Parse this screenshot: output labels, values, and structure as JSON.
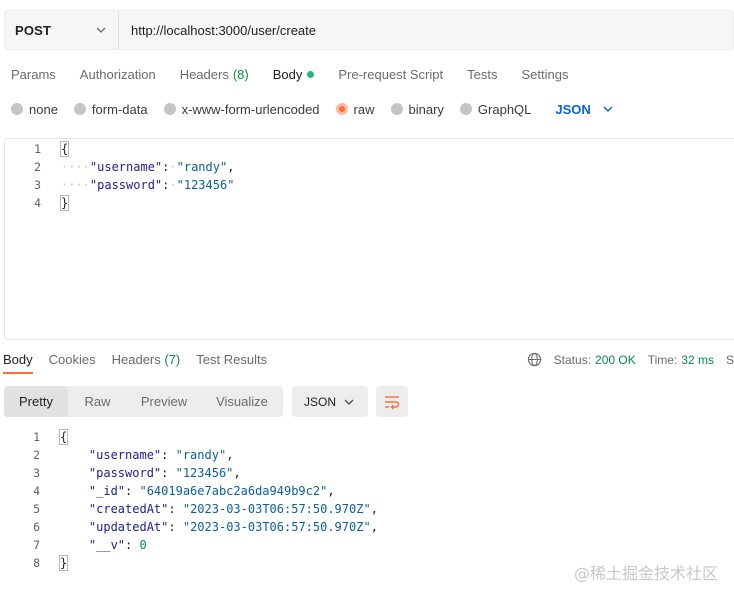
{
  "request": {
    "method": "POST",
    "url": "http://localhost:3000/user/create"
  },
  "request_tabs": [
    {
      "label": "Params"
    },
    {
      "label": "Authorization"
    },
    {
      "label": "Headers",
      "count": "(8)"
    },
    {
      "label": "Body"
    },
    {
      "label": "Pre-request Script"
    },
    {
      "label": "Tests"
    },
    {
      "label": "Settings"
    }
  ],
  "body_types": {
    "options": [
      "none",
      "form-data",
      "x-www-form-urlencoded",
      "raw",
      "binary",
      "GraphQL"
    ],
    "selected": "raw",
    "format": "JSON"
  },
  "request_body": {
    "line_numbers": [
      "1",
      "2",
      "3",
      "4"
    ],
    "open": "{",
    "close": "}",
    "indent_dots": "····",
    "pairs": [
      {
        "key": "\"username\"",
        "value": "\"randy\"",
        "comma": ","
      },
      {
        "key": "\"password\"",
        "value": "\"123456\"",
        "comma": ""
      }
    ]
  },
  "response_tabs": [
    {
      "label": "Body"
    },
    {
      "label": "Cookies"
    },
    {
      "label": "Headers",
      "count": "(7)"
    },
    {
      "label": "Test Results"
    }
  ],
  "response_status": {
    "status_label": "Status:",
    "status_value": "200 OK",
    "time_label": "Time:",
    "time_value": "32 ms",
    "cut_text": "S"
  },
  "response_view": {
    "modes": [
      "Pretty",
      "Raw",
      "Preview",
      "Visualize"
    ],
    "active": "Pretty",
    "format": "JSON"
  },
  "response_body": {
    "line_numbers": [
      "1",
      "2",
      "3",
      "4",
      "5",
      "6",
      "7",
      "8"
    ],
    "open": "{",
    "close": "}",
    "pairs": [
      {
        "key": "\"username\"",
        "value": "\"randy\"",
        "comma": ",",
        "type": "str"
      },
      {
        "key": "\"password\"",
        "value": "\"123456\"",
        "comma": ",",
        "type": "str"
      },
      {
        "key": "\"_id\"",
        "value": "\"64019a6e7abc2a6da949b9c2\"",
        "comma": ",",
        "type": "str"
      },
      {
        "key": "\"createdAt\"",
        "value": "\"2023-03-03T06:57:50.970Z\"",
        "comma": ",",
        "type": "str"
      },
      {
        "key": "\"updatedAt\"",
        "value": "\"2023-03-03T06:57:50.970Z\"",
        "comma": ",",
        "type": "str"
      },
      {
        "key": "\"__v\"",
        "value": "0",
        "comma": "",
        "type": "num"
      }
    ]
  },
  "watermark": "@稀土掘金技术社区",
  "colors": {
    "accent": "#ff6c37",
    "success": "#0c8a46",
    "link": "#0265d2"
  }
}
